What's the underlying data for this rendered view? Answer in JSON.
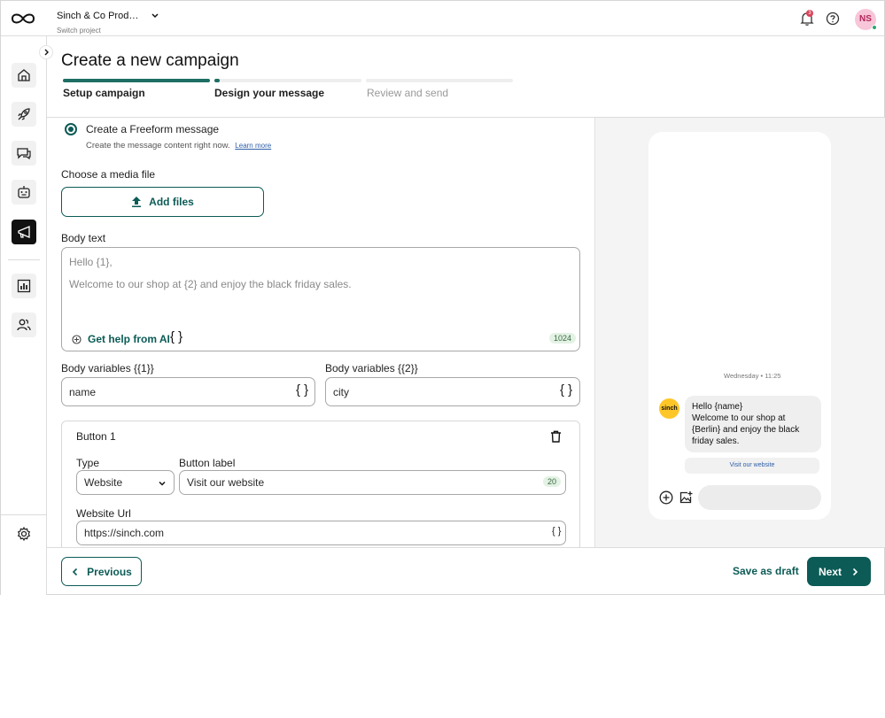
{
  "topbar": {
    "project_name": "Sinch & Co Productions",
    "project_sub": "Switch project",
    "notifications_count": "3",
    "avatar_initials": "NS"
  },
  "header": {
    "title": "Create a new campaign",
    "steps": [
      {
        "label": "Setup campaign",
        "state": "complete",
        "progress": 1.0
      },
      {
        "label": "Design your message",
        "state": "current",
        "progress": 0.03
      },
      {
        "label": "Review and send",
        "state": "upcoming",
        "progress": 0
      }
    ]
  },
  "form": {
    "radio_label": "Create a Freeform message",
    "radio_desc": "Create the message content right now.",
    "learn_more": "Learn more",
    "media_label": "Choose a media file",
    "add_files": "Add files",
    "body_label": "Body text",
    "body_line1": "Hello {1},",
    "body_line2": "Welcome to our shop at {2} and enjoy the black friday sales.",
    "ai_help": "Get help from AI",
    "body_counter": "1024",
    "var1_label": "Body variables {{1}}",
    "var1_value": "name",
    "var2_label": "Body variables {{2}}",
    "var2_value": "city",
    "button_card": {
      "title": "Button 1",
      "type_label": "Type",
      "type_value": "Website",
      "label_label": "Button label",
      "label_value": "Visit our website",
      "label_counter": "20",
      "url_label": "Website Url",
      "url_value": "https://sinch.com"
    }
  },
  "preview": {
    "timestamp": "Wednesday • 11:25",
    "avatar_text": "sinch",
    "message": "Hello {name}\nWelcome to our shop at {Berlin} and enjoy the black friday sales.",
    "chip": "Visit our website"
  },
  "footer": {
    "previous": "Previous",
    "save_draft": "Save as draft",
    "next": "Next"
  },
  "colors": {
    "accent": "#0c5b56",
    "step_complete": "#1d6e64",
    "step_upcoming": "#eeeeee"
  }
}
